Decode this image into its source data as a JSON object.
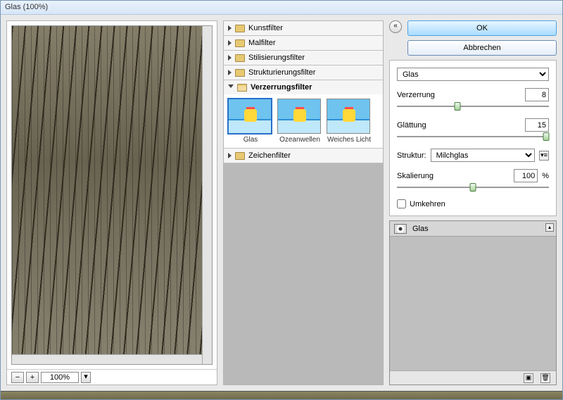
{
  "window": {
    "title": "Glas (100%)"
  },
  "zoom": {
    "minus": "−",
    "plus": "+",
    "value": "100%",
    "drop": "▾"
  },
  "categories": [
    {
      "key": "kunst",
      "label": "Kunstfilter",
      "open": false
    },
    {
      "key": "mal",
      "label": "Malfilter",
      "open": false
    },
    {
      "key": "stil",
      "label": "Stilisierungsfilter",
      "open": false
    },
    {
      "key": "strukt",
      "label": "Strukturierungsfilter",
      "open": false
    },
    {
      "key": "verz",
      "label": "Verzerrungsfilter",
      "open": true,
      "items": [
        {
          "key": "glas",
          "label": "Glas",
          "selected": true
        },
        {
          "key": "ozean",
          "label": "Ozeanwellen",
          "selected": false
        },
        {
          "key": "weich",
          "label": "Weiches Licht",
          "selected": false
        }
      ]
    },
    {
      "key": "zeich",
      "label": "Zeichenfilter",
      "open": false
    }
  ],
  "buttons": {
    "ok": "OK",
    "cancel": "Abbrechen"
  },
  "filterSelect": "Glas",
  "params": {
    "verzerrung": {
      "label": "Verzerrung",
      "value": "8",
      "pos": 40
    },
    "glaettung": {
      "label": "Glättung",
      "value": "15",
      "pos": 98
    },
    "struktur": {
      "label": "Struktur:",
      "value": "Milchglas"
    },
    "skalierung": {
      "label": "Skalierung",
      "value": "100",
      "unit": "%",
      "pos": 50
    },
    "umkehren": {
      "label": "Umkehren",
      "checked": false
    }
  },
  "layer": {
    "name": "Glas"
  },
  "icons": {
    "collapse": "«",
    "menu": "▾≡",
    "newlayer": "▣",
    "trash": "🗑",
    "up": "▴"
  }
}
